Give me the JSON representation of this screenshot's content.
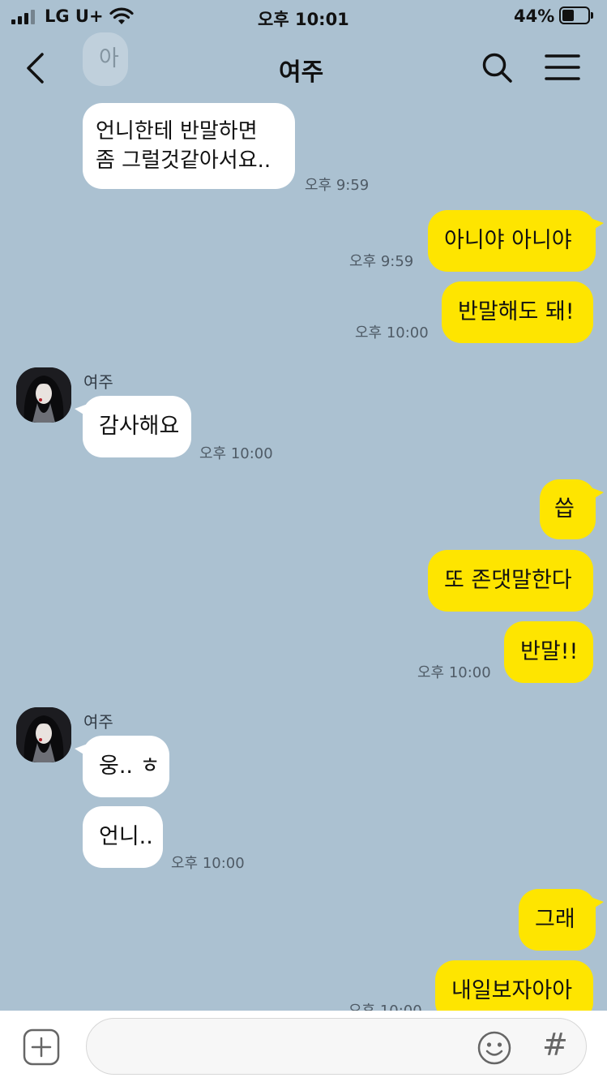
{
  "status_bar": {
    "carrier": "LG U+",
    "time": "오후 10:01",
    "battery": "44%"
  },
  "header": {
    "title": "여주",
    "back_icon": "chevron-left-icon",
    "search_icon": "search-icon",
    "menu_icon": "hamburger-menu-icon"
  },
  "messages": {
    "m0_partial": "아",
    "m1": "언니한테 반말하면\n좀 그럴것같아서요..",
    "m1_time": "오후 9:59",
    "m2": "아니야 아니야",
    "m2_time": "오후 9:59",
    "m3": "반말해도 돼!",
    "m3_time": "오후 10:00",
    "sender_name_1": "여주",
    "m4": "감사해요",
    "m4_time": "오후 10:00",
    "m5": "씁",
    "m6": "또 존댓말한다",
    "m7": "반말!!",
    "m7_time": "오후 10:00",
    "sender_name_2": "여주",
    "m8": "웅.. ㅎ",
    "m9": "언니..",
    "m9_time": "오후 10:00",
    "m10": "그래",
    "m11": "내일보자아아",
    "m11_time": "오후 10:00"
  },
  "input_bar": {
    "add_icon": "plus-square-icon",
    "emoji_icon": "smiley-icon",
    "hash_label": "#"
  },
  "colors": {
    "background": "#abc1d1",
    "outgoing_bubble": "#fee500",
    "incoming_bubble": "#ffffff"
  }
}
